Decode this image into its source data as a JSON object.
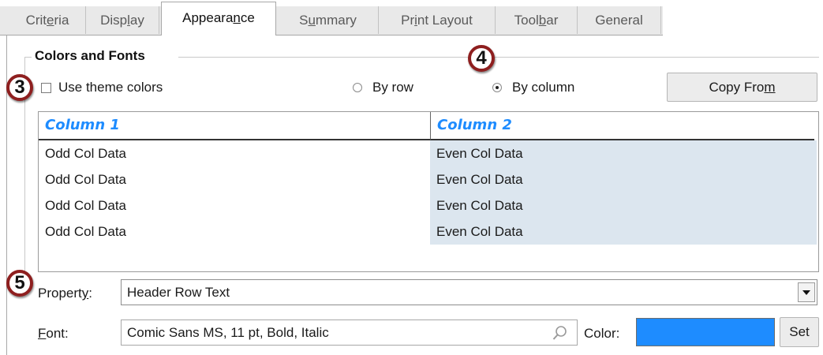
{
  "tabs": [
    {
      "label": "Criteria",
      "mnemonic_index": 4,
      "active": false
    },
    {
      "label": "Display",
      "mnemonic_index": 4,
      "active": false
    },
    {
      "label": "Appearance",
      "mnemonic_index": 7,
      "active": true
    },
    {
      "label": "Summary",
      "mnemonic_index": 1,
      "active": false
    },
    {
      "label": "Print Layout",
      "mnemonic_index": 2,
      "active": false
    },
    {
      "label": "Toolbar",
      "mnemonic_index": 4,
      "active": false
    },
    {
      "label": "General",
      "mnemonic_index": -1,
      "active": false
    }
  ],
  "group": {
    "title": "Colors and Fonts"
  },
  "callouts": {
    "three": "3",
    "four": "4",
    "five": "5"
  },
  "options": {
    "use_theme_colors": {
      "label": "Use theme colors",
      "checked": false
    },
    "by_row": {
      "label": "By row",
      "selected": false
    },
    "by_column": {
      "label": "By column",
      "selected": true
    },
    "copy_from": {
      "label_pre": "Copy Fro",
      "label_mnemonic": "m"
    }
  },
  "preview": {
    "columns": [
      "Column 1",
      "Column 2"
    ],
    "rows": [
      [
        "Odd Col Data",
        "Even Col Data"
      ],
      [
        "Odd Col Data",
        "Even Col Data"
      ],
      [
        "Odd Col Data",
        "Even Col Data"
      ],
      [
        "Odd Col Data",
        "Even Col Data"
      ]
    ],
    "header_text_color": "#1e8cff",
    "even_col_background": "#dce6ef"
  },
  "property": {
    "label_pre": "Propert",
    "label_mnemonic": "y",
    "label_post": ":",
    "value": "Header Row Text"
  },
  "font": {
    "label_mnemonic": "F",
    "label_post": "ont:",
    "value": "Comic Sans MS, 11 pt, Bold, Italic",
    "icon": "search-icon"
  },
  "color": {
    "label": "Color:",
    "swatch": "#1e8cff",
    "set_label": "Set"
  }
}
